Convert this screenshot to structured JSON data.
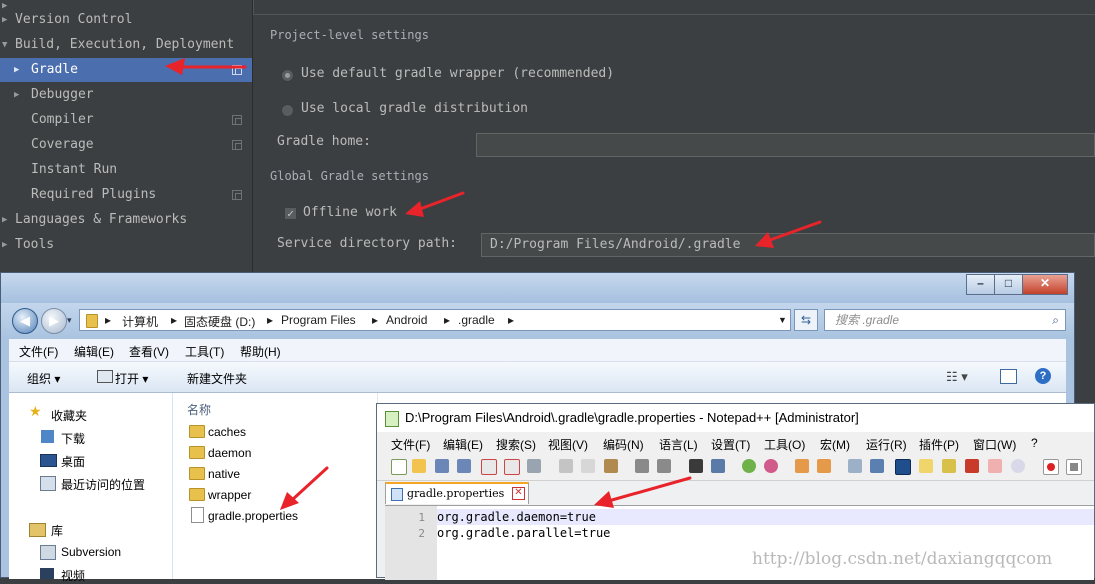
{
  "ide": {
    "sidebar_items": [
      {
        "label": "Version Control",
        "arrow": "▶",
        "indent": 0
      },
      {
        "label": "Build, Execution, Deployment",
        "arrow": "▼",
        "indent": 0
      },
      {
        "label": "Gradle",
        "arrow": "▶",
        "indent": 1,
        "selected": true
      },
      {
        "label": "Debugger",
        "arrow": "▶",
        "indent": 1
      },
      {
        "label": "Compiler",
        "indent": 1
      },
      {
        "label": "Coverage",
        "indent": 1
      },
      {
        "label": "Instant Run",
        "indent": 1
      },
      {
        "label": "Required Plugins",
        "indent": 1
      },
      {
        "label": "Languages & Frameworks",
        "arrow": "▶",
        "indent": 0
      },
      {
        "label": "Tools",
        "arrow": "▶",
        "indent": 0
      }
    ],
    "project_level_header": "Project-level settings",
    "radio_wrapper": "Use default gradle wrapper (recommended)",
    "radio_local": "Use local gradle distribution",
    "gradle_home_label": "Gradle home:",
    "global_header": "Global Gradle settings",
    "offline_work": "Offline work",
    "service_dir_label": "Service directory path:",
    "service_dir_value": "D:/Program Files/Android/.gradle"
  },
  "explorer": {
    "crumbs": [
      "计算机",
      "固态硬盘 (D:)",
      "Program Files",
      "Android",
      ".gradle"
    ],
    "search_placeholder": "搜索 .gradle",
    "menu": [
      "文件(F)",
      "编辑(E)",
      "查看(V)",
      "工具(T)",
      "帮助(H)"
    ],
    "toolbar": {
      "organize": "组织 ▾",
      "open": "打开 ▾",
      "new_folder": "新建文件夹"
    },
    "nav": {
      "favorites": "收藏夹",
      "downloads": "下载",
      "desktop": "桌面",
      "recent": "最近访问的位置",
      "libraries": "库",
      "subversion": "Subversion",
      "video": "视频"
    },
    "column_name": "名称",
    "files": [
      {
        "name": "caches",
        "type": "folder"
      },
      {
        "name": "daemon",
        "type": "folder"
      },
      {
        "name": "native",
        "type": "folder"
      },
      {
        "name": "wrapper",
        "type": "folder"
      },
      {
        "name": "gradle.properties",
        "type": "file"
      }
    ]
  },
  "notepad": {
    "title": "D:\\Program Files\\Android\\.gradle\\gradle.properties - Notepad++ [Administrator]",
    "menu": [
      "文件(F)",
      "编辑(E)",
      "搜索(S)",
      "视图(V)",
      "编码(N)",
      "语言(L)",
      "设置(T)",
      "工具(O)",
      "宏(M)",
      "运行(R)",
      "插件(P)",
      "窗口(W)",
      "?"
    ],
    "tab": "gradle.properties",
    "lines": [
      "org.gradle.daemon=true",
      "org.gradle.parallel=true"
    ],
    "line_numbers": [
      "1",
      "2"
    ]
  },
  "watermark": "http://blog.csdn.net/daxiangqqcom",
  "colors": {
    "ide_bg": "#3c3f41",
    "selection": "#4b6eaf",
    "arrow_red": "#e8232a"
  }
}
